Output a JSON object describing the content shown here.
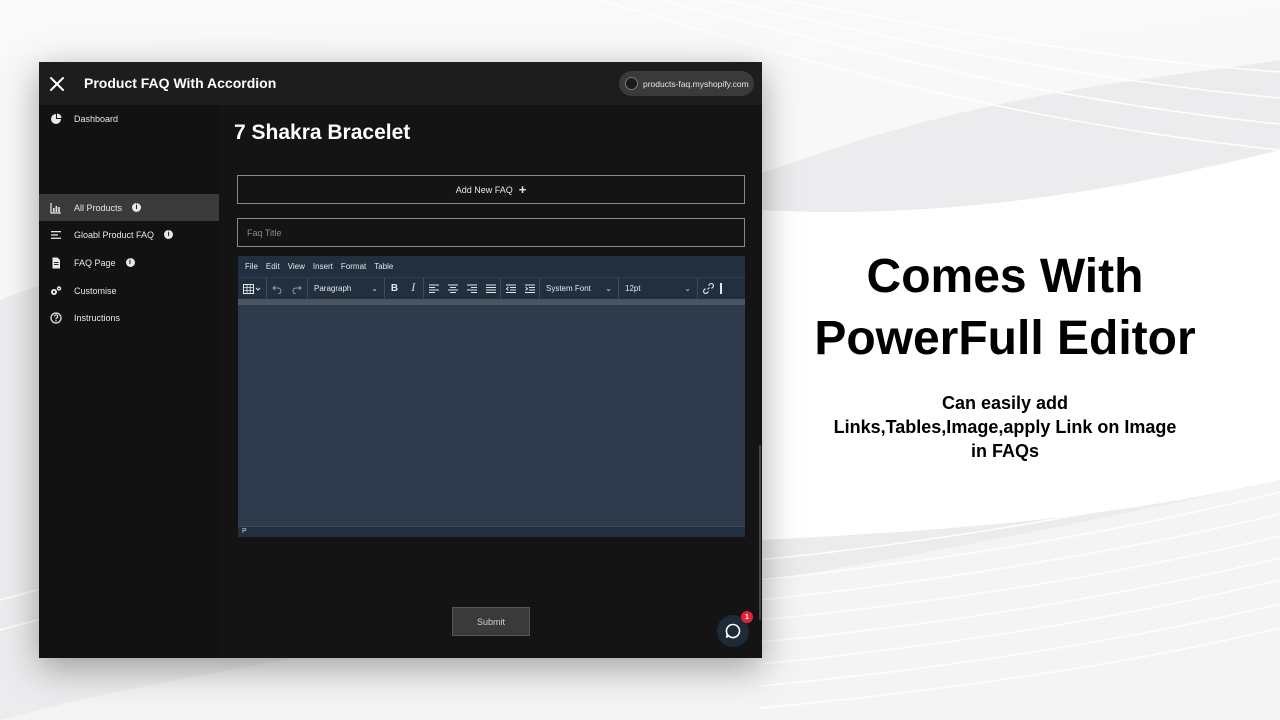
{
  "app": {
    "title": "Product FAQ With Accordion",
    "shop_domain": "products-faq.myshopify.com"
  },
  "sidebar": {
    "items": [
      {
        "label": "Dashboard",
        "icon": "pie-chart-icon",
        "active": false,
        "info": false
      },
      {
        "label": "All Products",
        "icon": "bar-chart-icon",
        "active": true,
        "info": true
      },
      {
        "label": "Gloabl Product FAQ",
        "icon": "list-icon",
        "active": false,
        "info": true
      },
      {
        "label": "FAQ Page",
        "icon": "document-icon",
        "active": false,
        "info": true
      },
      {
        "label": "Customise",
        "icon": "gears-icon",
        "active": false,
        "info": false
      },
      {
        "label": "Instructions",
        "icon": "question-circle-icon",
        "active": false,
        "info": false
      }
    ],
    "info_glyph": "i"
  },
  "main": {
    "title": "7 Shakra Bracelet",
    "add_faq_label": "Add New FAQ",
    "add_faq_plus": "+",
    "faq_title_placeholder": "Faq Title",
    "submit_label": "Submit",
    "chat_badge": "1"
  },
  "editor": {
    "menu": [
      "File",
      "Edit",
      "View",
      "Insert",
      "Format",
      "Table"
    ],
    "block_format": "Paragraph",
    "font_family": "System Font",
    "font_size": "12pt",
    "status_path": "P"
  },
  "promo": {
    "headline_line1": "Comes With",
    "headline_line2": "PowerFull Editor",
    "sub_line1": "Can easily add",
    "sub_line2": "Links,Tables,Image,apply Link on Image",
    "sub_line3": "in FAQs"
  },
  "colors": {
    "app_background": "#121212",
    "topbar": "#1d1d1d",
    "active_item": "#3a3a3a",
    "editor_toolbar": "#222f3e",
    "editor_body": "#2f3b4d",
    "chat_badge": "#e0233a"
  }
}
